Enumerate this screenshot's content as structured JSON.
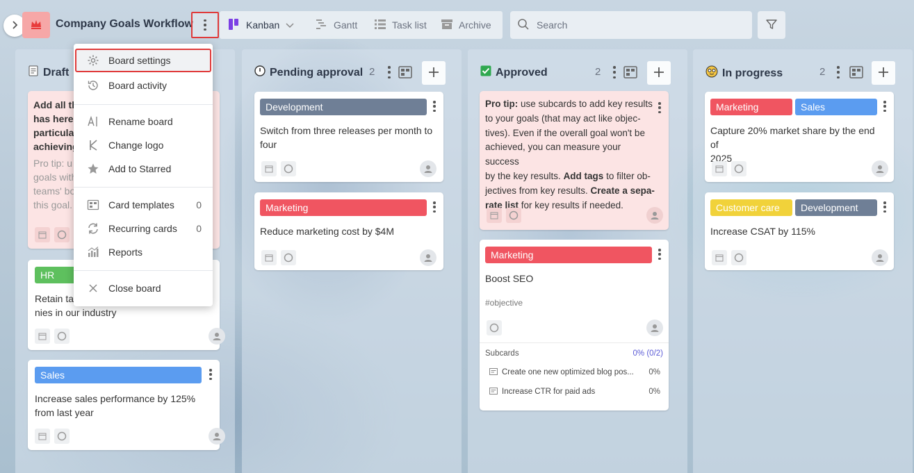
{
  "board": {
    "title": "Company Goals Workflow"
  },
  "views": [
    {
      "label": "Kanban",
      "icon": "kanban-icon",
      "active": true
    },
    {
      "label": "Gantt",
      "icon": "gantt-icon"
    },
    {
      "label": "Task list",
      "icon": "task-list-icon"
    },
    {
      "label": "Archive",
      "icon": "archive-icon"
    }
  ],
  "search": {
    "placeholder": "Search"
  },
  "columns": [
    {
      "title": "Drafts",
      "title_visible": "Draft",
      "cards": [
        {
          "lines": [
            "Add all th",
            "has here.",
            "particula",
            "achieving"
          ],
          "protip_lines": [
            "Pro tip: u",
            "goals with",
            "teams' bo",
            "this goal."
          ]
        },
        {
          "tag": "HR",
          "lines": [
            "Retain tal",
            "nies in our industry"
          ]
        },
        {
          "tag": "Sales",
          "lines": [
            "Increase sales performance by 125%",
            "from last year"
          ]
        }
      ]
    },
    {
      "title": "Pending approval",
      "count": "2",
      "cards": [
        {
          "tag": "Development",
          "lines": [
            "Switch from three releases per month to",
            "four"
          ]
        },
        {
          "tag": "Marketing",
          "lines": [
            "Reduce marketing cost by $4M"
          ]
        }
      ]
    },
    {
      "title": "Approved",
      "count": "2",
      "cards": [
        {
          "lines": [
            {
              "bold": "Pro tip:",
              "rest": " use subcards to add key results"
            },
            {
              "text": "to your goals (that may act like objec-"
            },
            {
              "text": "tives). Even if the overall goal won't be"
            },
            {
              "text": "achieved, you can measure your success"
            },
            {
              "pre": "by the key results. ",
              "bold": "Add tags",
              "rest": " to filter ob-"
            },
            {
              "pre": "jectives from key results. ",
              "bold": "Create a sepa-"
            },
            {
              "bold": "rate list",
              "rest": " for key results if needed."
            }
          ]
        },
        {
          "tag": "Marketing",
          "lines": [
            "Boost SEO"
          ],
          "hashtag": "#objective",
          "subcards_label": "Subcards",
          "subcards_progress": "0% (0/2)",
          "subcards": [
            {
              "text": "Create one new optimized blog pos...",
              "pct": "0%"
            },
            {
              "text": "Increase CTR for paid ads",
              "pct": "0%"
            }
          ]
        }
      ]
    },
    {
      "title": "In progress",
      "count": "2",
      "cards": [
        {
          "tags": [
            "Marketing",
            "Sales"
          ],
          "lines": [
            "Capture 20% market share by the end of",
            "2025"
          ]
        },
        {
          "tags": [
            "Customer care",
            "Development"
          ],
          "lines": [
            "Increase CSAT by 115%"
          ]
        }
      ]
    }
  ],
  "menu": {
    "items": [
      {
        "label": "Board settings",
        "icon": "gear-icon"
      },
      {
        "label": "Board activity",
        "icon": "history-icon"
      },
      {
        "label": "Rename board",
        "icon": "rename-icon"
      },
      {
        "label": "Change logo",
        "icon": "logo-icon"
      },
      {
        "label": "Add to Starred",
        "icon": "star-icon"
      },
      {
        "label": "Card templates",
        "icon": "card-templates-icon",
        "count": "0"
      },
      {
        "label": "Recurring cards",
        "icon": "recurring-icon",
        "count": "0"
      },
      {
        "label": "Reports",
        "icon": "reports-icon"
      },
      {
        "label": "Close board",
        "icon": "close-icon"
      }
    ]
  },
  "colors": {
    "accent": "#7b3fe4",
    "highlight": "#e03a3a",
    "tag_dark": "#6f7f96",
    "tag_red": "#f05561",
    "tag_blue": "#5b9cf0",
    "tag_yellow": "#f1d23a",
    "tag_green": "#5ec05e"
  }
}
